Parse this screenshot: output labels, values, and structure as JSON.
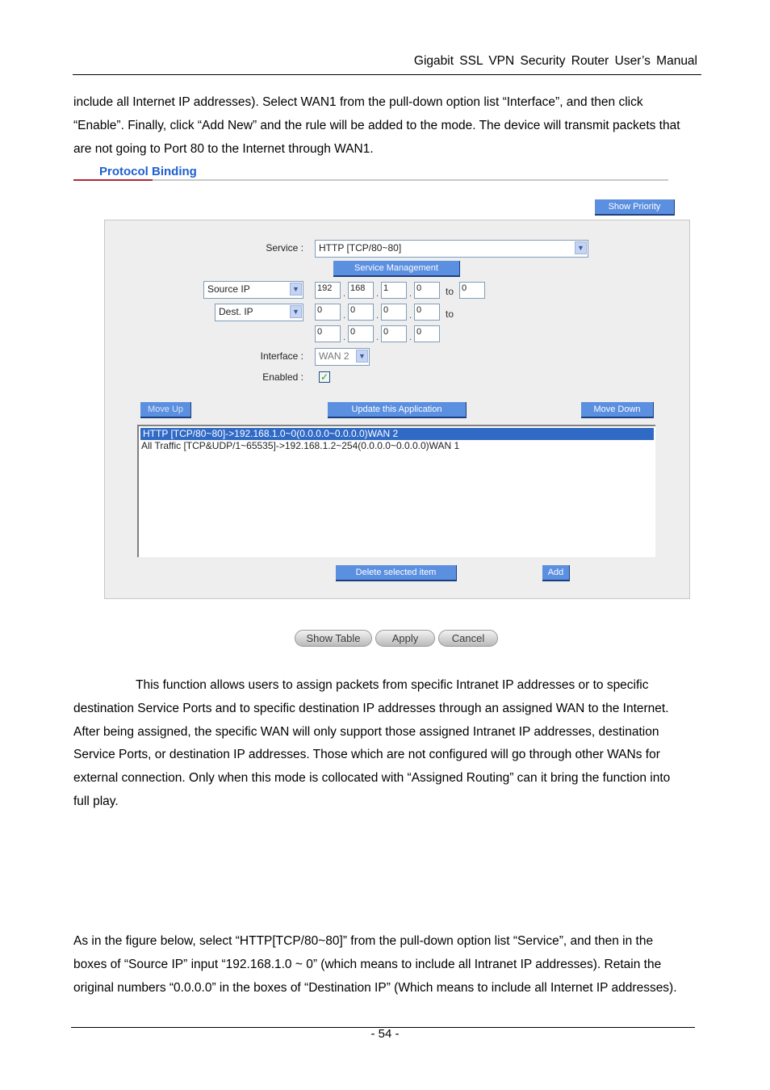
{
  "header": {
    "title": "Gigabit SSL VPN Security Router User’s Manual"
  },
  "intro": [
    "include all Internet IP addresses). Select WAN1 from the pull-down option list “Interface”, and then click",
    "“Enable”. Finally, click “Add New” and the rule will be added to the mode. The device will transmit packets that",
    "are not going to Port 80 to the Internet through WAN1."
  ],
  "section": {
    "title": "Protocol Binding"
  },
  "ui": {
    "show_priority": "Show Priority",
    "service_label": "Service :",
    "service_value": "HTTP [TCP/80~80]",
    "service_mgmt": "Service Management",
    "source_select": "Source IP",
    "source_ip": [
      "192",
      "168",
      "1",
      "0"
    ],
    "source_to": "0",
    "to_label": "to",
    "dest_select": "Dest. IP",
    "dest_ip_from": [
      "0",
      "0",
      "0",
      "0"
    ],
    "dest_ip_to": [
      "0",
      "0",
      "0",
      "0"
    ],
    "interface_label": "Interface :",
    "interface_value": "WAN 2",
    "enabled_label": "Enabled :",
    "enabled": true,
    "move_up": "Move Up",
    "update": "Update this Application",
    "move_down": "Move Down",
    "rules": [
      "HTTP [TCP/80~80]->192.168.1.0~0(0.0.0.0~0.0.0.0)WAN 2",
      "All Traffic [TCP&UDP/1~65535]->192.168.1.2~254(0.0.0.0~0.0.0.0)WAN 1"
    ],
    "delete": "Delete selected item",
    "add": "Add",
    "show_table": "Show Table",
    "apply": "Apply",
    "cancel": "Cancel"
  },
  "body2": [
    "This function allows users to assign packets from specific Intranet IP addresses or to specific",
    "destination Service Ports and to specific destination IP addresses through an assigned WAN to the Internet.",
    "After being assigned, the specific WAN will only support those assigned Intranet IP addresses, destination",
    "Service Ports, or destination IP addresses. Those which are not configured will go through other WANs for",
    "external connection. Only when this mode is collocated with “Assigned Routing” can it bring the function into",
    "full play."
  ],
  "body3": [
    "As in the figure below, select “HTTP[TCP/80~80]” from the pull-down option list “Service”, and then in the",
    "boxes of “Source IP” input “192.168.1.0 ~ 0” (which means to include all Intranet IP addresses). Retain the",
    "original numbers “0.0.0.0” in the boxes of “Destination IP” (Which means to include all Internet IP addresses)."
  ],
  "footer": {
    "page": "- 54 -"
  }
}
